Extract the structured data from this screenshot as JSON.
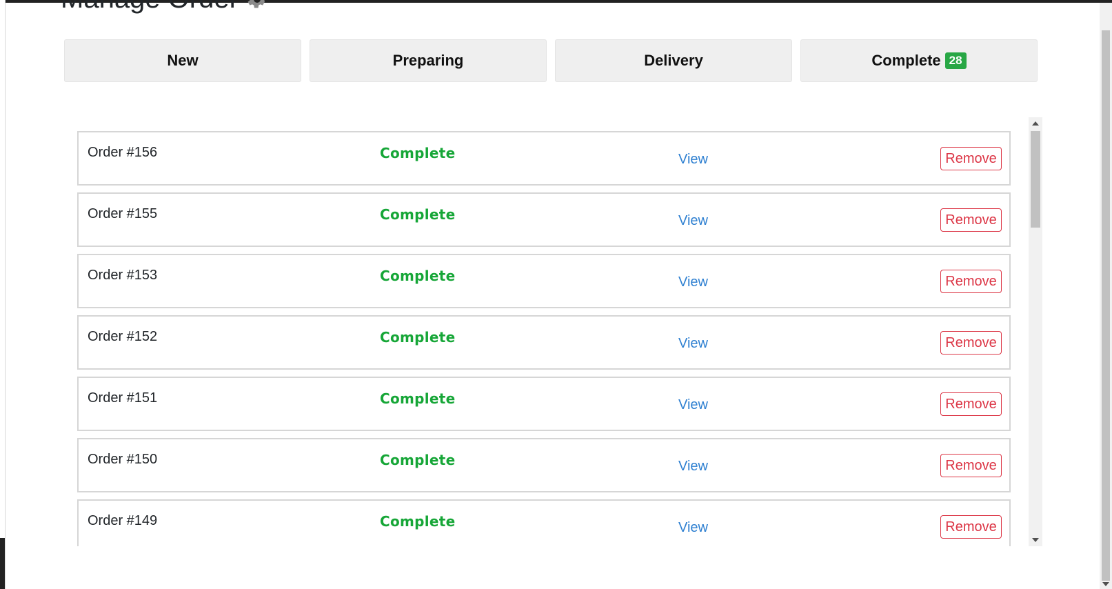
{
  "page": {
    "title": "Manage Order"
  },
  "tabs": [
    {
      "label": "New"
    },
    {
      "label": "Preparing"
    },
    {
      "label": "Delivery"
    },
    {
      "label": "Complete",
      "badge": "28"
    }
  ],
  "orders": [
    {
      "id": "Order #156",
      "status": "Complete",
      "view": "View",
      "remove": "Remove"
    },
    {
      "id": "Order #155",
      "status": "Complete",
      "view": "View",
      "remove": "Remove"
    },
    {
      "id": "Order #153",
      "status": "Complete",
      "view": "View",
      "remove": "Remove"
    },
    {
      "id": "Order #152",
      "status": "Complete",
      "view": "View",
      "remove": "Remove"
    },
    {
      "id": "Order #151",
      "status": "Complete",
      "view": "View",
      "remove": "Remove"
    },
    {
      "id": "Order #150",
      "status": "Complete",
      "view": "View",
      "remove": "Remove"
    },
    {
      "id": "Order #149",
      "status": "Complete",
      "view": "View",
      "remove": "Remove"
    }
  ],
  "colors": {
    "status_complete": "#16a637",
    "link": "#2f80d1",
    "danger": "#dc3545",
    "badge": "#28a745",
    "tab_bg": "#efefef"
  },
  "icons": {
    "title_icon": "gear-icon"
  }
}
